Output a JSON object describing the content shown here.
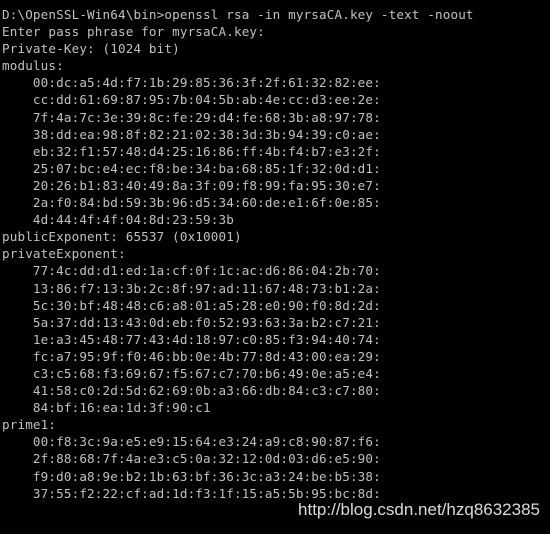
{
  "console": {
    "lines": [
      "D:\\OpenSSL-Win64\\bin>openssl rsa -in myrsaCA.key -text -noout",
      "Enter pass phrase for myrsaCA.key:",
      "Private-Key: (1024 bit)",
      "modulus:",
      "    00:dc:a5:4d:f7:1b:29:85:36:3f:2f:61:32:82:ee:",
      "    cc:dd:61:69:87:95:7b:04:5b:ab:4e:cc:d3:ee:2e:",
      "    7f:4a:7c:3e:39:8c:fe:29:d4:fe:68:3b:a8:97:78:",
      "    38:dd:ea:98:8f:82:21:02:38:3d:3b:94:39:c0:ae:",
      "    eb:32:f1:57:48:d4:25:16:86:ff:4b:f4:b7:e3:2f:",
      "    25:07:bc:e4:ec:f8:be:34:ba:68:85:1f:32:0d:d1:",
      "    20:26:b1:83:40:49:8a:3f:09:f8:99:fa:95:30:e7:",
      "    2a:f0:84:bd:59:3b:96:d5:34:60:de:e1:6f:0e:85:",
      "    4d:44:4f:4f:04:8d:23:59:3b",
      "publicExponent: 65537 (0x10001)",
      "privateExponent:",
      "    77:4c:dd:d1:ed:1a:cf:0f:1c:ac:d6:86:04:2b:70:",
      "    13:86:f7:13:3b:2c:8f:97:ad:11:67:48:73:b1:2a:",
      "    5c:30:bf:48:48:c6:a8:01:a5:28:e0:90:f0:8d:2d:",
      "    5a:37:dd:13:43:0d:eb:f0:52:93:63:3a:b2:c7:21:",
      "    1e:a3:45:48:77:43:4d:18:97:c0:85:f3:94:40:74:",
      "    fc:a7:95:9f:f0:46:bb:0e:4b:77:8d:43:00:ea:29:",
      "    c3:c5:68:f3:69:67:f5:67:c7:70:b6:49:0e:a5:e4:",
      "    41:58:c0:2d:5d:62:69:0b:a3:66:db:84:c3:c7:80:",
      "    84:bf:16:ea:1d:3f:90:c1",
      "prime1:",
      "    00:f8:3c:9a:e5:e9:15:64:e3:24:a9:c8:90:87:f6:",
      "    2f:88:68:7f:4a:e3:c5:0a:32:12:0d:03:d6:e5:90:",
      "    f9:d0:a8:9e:b2:1b:63:bf:36:3c:a3:24:be:b5:38:",
      "    37:55:f2:22:cf:ad:1d:f3:1f:15:a5:5b:95:bc:8d:"
    ]
  },
  "watermark": {
    "text": "http://blog.csdn.net/hzq8632385"
  },
  "colors": {
    "background": "#000000",
    "text": "#c0c0c0"
  }
}
